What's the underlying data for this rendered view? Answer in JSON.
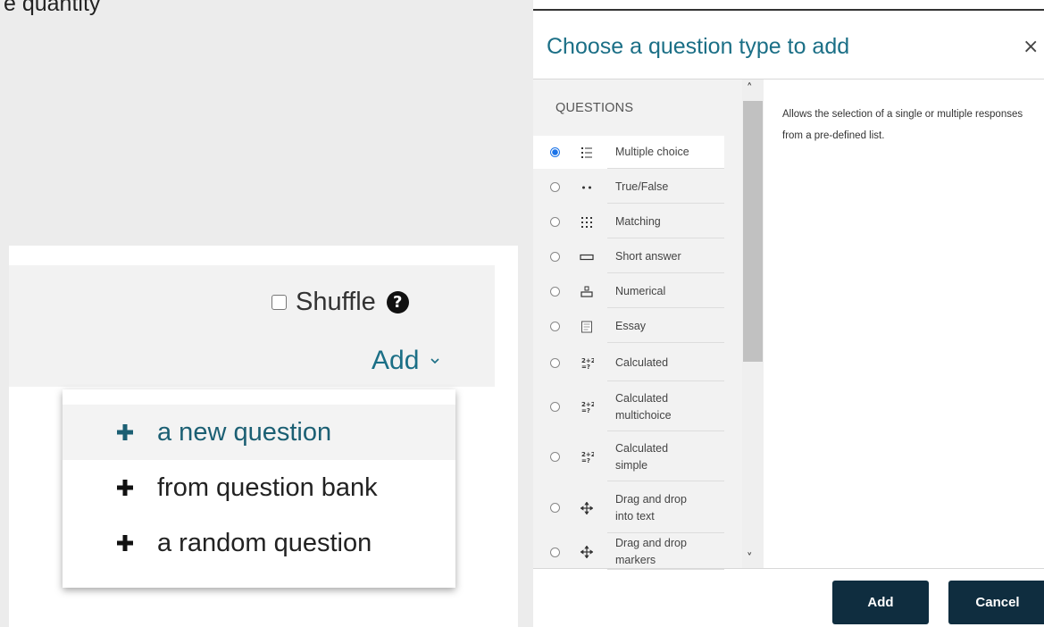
{
  "top_fragment": "e quantity",
  "toolbar": {
    "shuffle_label": "Shuffle",
    "help_icon": "?",
    "add_label": "Add"
  },
  "add_menu": {
    "items": [
      "a new question",
      "from question bank",
      "a random question"
    ]
  },
  "dialog": {
    "title": "Choose a question type to add",
    "close": "×",
    "section": "QUESTIONS",
    "items": [
      [
        "Multiple choice"
      ],
      [
        "True/False"
      ],
      [
        "Matching"
      ],
      [
        "Short answer"
      ],
      [
        "Numerical"
      ],
      [
        "Essay"
      ],
      [
        "Calculated"
      ],
      [
        "Calculated",
        "multichoice"
      ],
      [
        "Calculated",
        "simple"
      ],
      [
        "Drag and drop",
        "into text"
      ],
      [
        "Drag and drop",
        "markers"
      ]
    ],
    "selected_index": 0,
    "description": "Allows the selection of a single or multiple responses from a pre-defined list.",
    "add_button": "Add",
    "cancel_button": "Cancel"
  },
  "colors": {
    "link": "#1b6f86",
    "button": "#0f2d3f",
    "radio_selected": "#1a73e8"
  }
}
